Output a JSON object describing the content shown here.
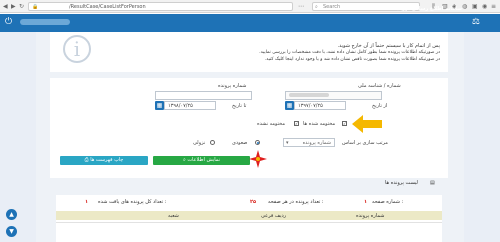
{
  "browser": {
    "url": "/ResultCase/CaseListForPerson",
    "url_host": "adliran.ir",
    "search_placeholder": "Search"
  },
  "header": {
    "title": "سامانه اطلاع رسانی پرونده"
  },
  "info": {
    "line1": "پس از اتمام کار با سیستم حتماً از آن خارج شوید.",
    "line2": "در صورتیکه اطلاعات پرونده شما بطور کامل نشان داده نشد، با دقت مشخصات را بررسی نمایید.",
    "line3": "در صورتیکه اطلاعات پرونده شما بصورت ناقص نشان داده شد و یا وجود ندارد اینجا کلیک کنید.",
    "line3_link": "اینجا"
  },
  "form": {
    "national_id_label": "شماره / شناسه ملی",
    "case_number_label": "شماره پرونده",
    "from_date_label": "از تاریخ",
    "to_date_label": "تا تاریخ",
    "from_date_value": "۱۳۹۷/۰۷/۲۵",
    "to_date_value": "۱۳۹۸/۰۷/۲۵",
    "archived_label": "مختومه شده ها",
    "not_archived_label": "مختومه نشده",
    "sort_label": "مرتب سازی بر اساس",
    "sort_value": "شماره پرونده",
    "asc_label": "صعودی",
    "desc_label": "نزولی",
    "show_button": "نمایش اطلاعات",
    "print_button": "چاپ فهرست ها"
  },
  "list": {
    "title": "لیست پرونده ها",
    "page_label": "شماره صفحه :",
    "page_value": "۱",
    "per_page_label": "تعداد پرونده در هر صفحه :",
    "per_page_value": "۲۵",
    "total_label": "تعداد کل پرونده های یافت شده :",
    "total_value": "۱",
    "col_case_number": "شماره پرونده",
    "col_row": "ردیف فرعی",
    "col_branch": "شعبه"
  },
  "colors": {
    "header": "#1e72b6",
    "show_button": "#27a844",
    "print_button": "#2aa6c4",
    "arrow": "#f5b800",
    "star": "#e01e1e",
    "total_red": "#d9231d"
  }
}
